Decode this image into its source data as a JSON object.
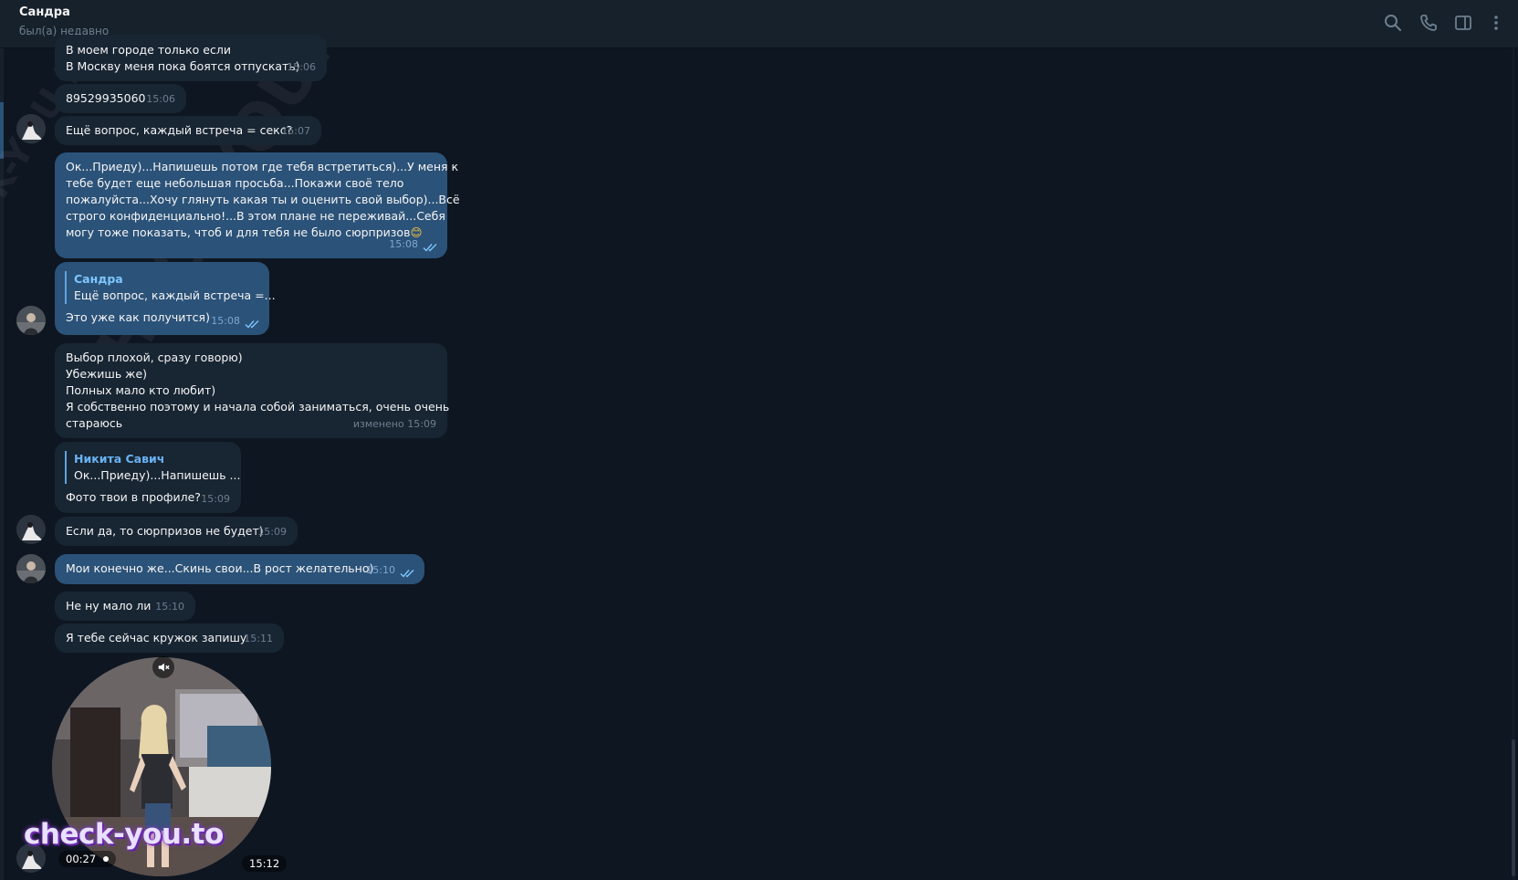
{
  "header": {
    "name": "Сандра",
    "status": "был(а) недавно"
  },
  "icons": {
    "search": "search-icon",
    "call": "phone-icon",
    "sidebar": "sidebar-toggle-icon",
    "more": "more-vertical-icon"
  },
  "watermarks": {
    "big": "CHECK-YOU.ME",
    "bottom": "check-you.to"
  },
  "messages": {
    "m1": {
      "lines": [
        "В моем городе только если",
        "В Москву меня пока боятся отпускать)"
      ],
      "time": "15:06"
    },
    "m2": {
      "text": "89529935060",
      "time": "15:06"
    },
    "m3": {
      "text": "Ещё вопрос, каждый встреча = секс?",
      "time": "15:07"
    },
    "m4": {
      "lines": [
        "Ок...Приеду)...Напишешь потом где тебя встретиться)...У меня к",
        "тебе будет еще небольшая просьба...Покажи своё тело",
        "пожалуйста...Хочу глянуть какая ты и оценить свой выбор)...Всё",
        "строго конфиденциально!...В этом плане не переживай...Себя",
        "могу тоже показать, чтоб и для тебя не было сюрпризов"
      ],
      "emoji": "😊",
      "time": "15:08"
    },
    "m5": {
      "reply_name": "Сандра",
      "reply_text": "Ещё вопрос, каждый встреча =...",
      "text": "Это уже как получится)",
      "time": "15:08"
    },
    "m6": {
      "lines": [
        "Выбор плохой, сразу говорю)",
        "Убежишь же)",
        "Полных мало кто любит)",
        "Я собственно поэтому и начала собой заниматься, очень очень",
        "стараюсь"
      ],
      "time": "изменено 15:09"
    },
    "m7": {
      "reply_name": "Никита Савич",
      "reply_text": "Ок...Приеду)...Напишешь ...",
      "text": "Фото твои в профиле?",
      "time": "15:09"
    },
    "m8": {
      "text": "Если да, то сюрпризов не будет)",
      "time": "15:09"
    },
    "m9": {
      "text": "Мои конечно же...Скинь свои...В рост желательно)",
      "time": "15:10"
    },
    "m10": {
      "text": "Не ну мало ли",
      "time": "15:10"
    },
    "m11": {
      "text": "Я тебе сейчас кружок запишу",
      "time": "15:11"
    },
    "video": {
      "duration": "00:27",
      "time": "15:12"
    }
  }
}
